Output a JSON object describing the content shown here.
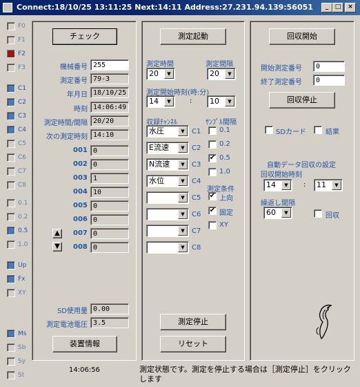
{
  "title": "Connect:18/10/25  13:11:25  Next:14:11  Address:27.231.94.139:56051",
  "sidebar": [
    {
      "label": "F0",
      "state": "grey"
    },
    {
      "label": "F1",
      "state": "grey"
    },
    {
      "label": "F2",
      "state": "red"
    },
    {
      "label": "F3",
      "state": "grey"
    },
    {
      "label": "C1",
      "state": "blue"
    },
    {
      "label": "C2",
      "state": "blue"
    },
    {
      "label": "C3",
      "state": "blue"
    },
    {
      "label": "C4",
      "state": "blue"
    },
    {
      "label": "C5",
      "state": "grey"
    },
    {
      "label": "C6",
      "state": "grey"
    },
    {
      "label": "C7",
      "state": "grey"
    },
    {
      "label": "C8",
      "state": "grey"
    },
    {
      "label": "0.1",
      "state": "grey"
    },
    {
      "label": "0.2",
      "state": "grey"
    },
    {
      "label": "0.5",
      "state": "blue"
    },
    {
      "label": "1.0",
      "state": "grey"
    },
    {
      "label": "Up",
      "state": "blue"
    },
    {
      "label": "Fx",
      "state": "blue"
    },
    {
      "label": "XY",
      "state": "grey"
    },
    {
      "label": "Ms",
      "state": "blue"
    },
    {
      "label": "Sb",
      "state": "grey"
    },
    {
      "label": "Sy",
      "state": "grey"
    },
    {
      "label": "St",
      "state": "grey"
    }
  ],
  "left": {
    "check_button": "チェック",
    "machine_no_label": "機械番号",
    "machine_no": "255",
    "measure_no_label": "測定番号",
    "measure_no": "79-3",
    "date_label": "年月日",
    "date": "18/10/25",
    "time_label": "時刻",
    "time": "14:06:49",
    "interval_label": "測定時間/間隔",
    "interval": "20/20",
    "next_label": "次の測定時刻",
    "next": "14:10",
    "channels": [
      {
        "no": "001",
        "value": "0"
      },
      {
        "no": "002",
        "value": "0"
      },
      {
        "no": "003",
        "value": "1"
      },
      {
        "no": "004",
        "value": "10"
      },
      {
        "no": "005",
        "value": "0"
      },
      {
        "no": "006",
        "value": "0"
      },
      {
        "no": "007",
        "value": "0"
      },
      {
        "no": "008",
        "value": "0"
      }
    ],
    "up_arrow": "▲",
    "down_arrow": "▼",
    "sd_usage_label": "SD使用量",
    "sd_usage": "0.00",
    "battery_label": "測定電池電圧",
    "battery": "3.5",
    "device_info_button": "装置情報"
  },
  "middle": {
    "start_button": "測定起動",
    "measure_time_label": "測定時間",
    "measure_time": "20",
    "measure_interval_label": "測定間隔",
    "measure_interval": "20",
    "start_time_label": "測定開始時刻(時:分)",
    "start_hour": "14",
    "start_min": "10",
    "colon": ":",
    "record_channel_label": "収録ﾁｬﾝﾈﾙ",
    "sample_interval_label": "ｻﾝﾌﾟﾙ間隔",
    "channels": [
      {
        "value": "水圧",
        "label": "C1"
      },
      {
        "value": "E流速",
        "label": "C2"
      },
      {
        "value": "N流速",
        "label": "C3"
      },
      {
        "value": "水位",
        "label": "C4"
      },
      {
        "value": "",
        "label": "C5"
      },
      {
        "value": "",
        "label": "C6"
      },
      {
        "value": "",
        "label": "C7"
      },
      {
        "value": "",
        "label": "C8"
      }
    ],
    "samples": [
      {
        "label": "0.1",
        "checked": false
      },
      {
        "label": "0.2",
        "checked": false
      },
      {
        "label": "0.5",
        "checked": true
      },
      {
        "label": "1.0",
        "checked": false
      }
    ],
    "cond_label": "測定条件",
    "conds": [
      {
        "label": "上向",
        "checked": true
      },
      {
        "label": "固定",
        "checked": true
      },
      {
        "label": "XY",
        "checked": false
      }
    ],
    "stop_button": "測定停止",
    "reset_button": "リセット"
  },
  "right": {
    "collect_start_button": "回収開始",
    "start_no_label": "開始測定番号",
    "start_no": "0",
    "end_no_label": "終了測定番号",
    "end_no": "0",
    "collect_stop_button": "回収停止",
    "sd_card_label": "SDカード",
    "result_label": "結果",
    "auto_label": "自動データ回収の設定",
    "collect_time_label": "回収開始時刻",
    "collect_hour": "14",
    "collect_min": "11",
    "colon": ":",
    "repeat_label": "繰返し間隔",
    "repeat": "60",
    "collect_label": "回収"
  },
  "status": {
    "time": "14:06:56",
    "message": "測定状態です。測定を停止する場合は［測定停止］をクリックします"
  }
}
